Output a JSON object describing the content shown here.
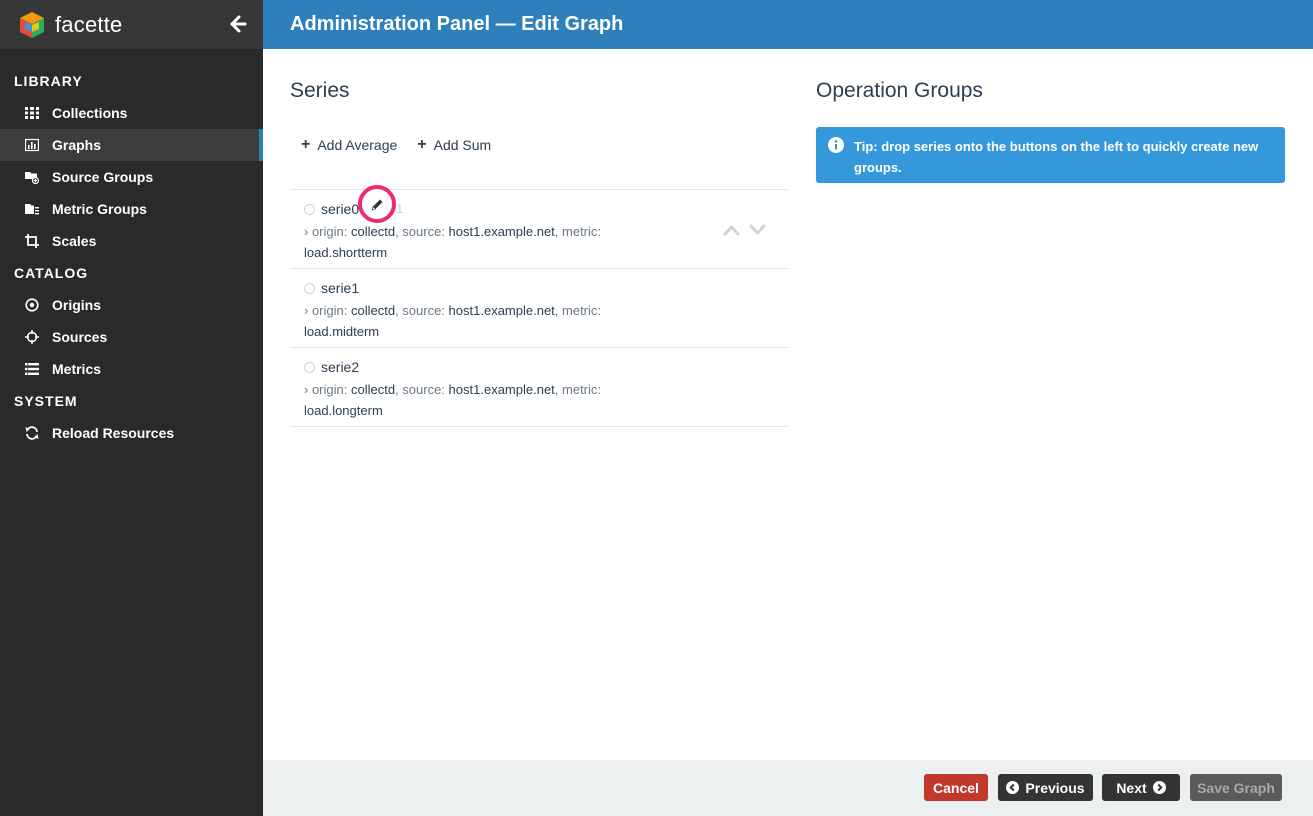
{
  "brand": {
    "name": "facette"
  },
  "sidebar": {
    "sections": [
      {
        "title": "LIBRARY",
        "items": [
          {
            "label": "Collections",
            "icon": "grid-icon"
          },
          {
            "label": "Graphs",
            "icon": "bar-chart-icon",
            "active": true
          },
          {
            "label": "Source Groups",
            "icon": "folder-plus-icon"
          },
          {
            "label": "Metric Groups",
            "icon": "folder-list-icon"
          },
          {
            "label": "Scales",
            "icon": "crop-icon"
          }
        ]
      },
      {
        "title": "CATALOG",
        "items": [
          {
            "label": "Origins",
            "icon": "dot-circle-icon"
          },
          {
            "label": "Sources",
            "icon": "crosshairs-icon"
          },
          {
            "label": "Metrics",
            "icon": "list-icon"
          }
        ]
      },
      {
        "title": "SYSTEM",
        "items": [
          {
            "label": "Reload Resources",
            "icon": "refresh-icon"
          }
        ]
      }
    ]
  },
  "header": {
    "title": "Administration Panel — Edit Graph"
  },
  "series_panel": {
    "title": "Series",
    "add_average": "Add Average",
    "add_sum": "Add Sum",
    "items": [
      {
        "name": "serie0",
        "ghost": "1",
        "origin_label": "› origin:",
        "origin": "collectd",
        "source_label": ", source:",
        "source": "host1.example.net",
        "metric_label": ", metric:",
        "metric": "load.shortterm"
      },
      {
        "name": "serie1",
        "origin_label": "› origin:",
        "origin": "collectd",
        "source_label": ", source:",
        "source": "host1.example.net",
        "metric_label": ", metric:",
        "metric": "load.midterm"
      },
      {
        "name": "serie2",
        "origin_label": "› origin:",
        "origin": "collectd",
        "source_label": ", source:",
        "source": "host1.example.net",
        "metric_label": ", metric:",
        "metric": "load.longterm"
      }
    ]
  },
  "operations_panel": {
    "title": "Operation Groups",
    "tip": "Tip: drop series onto the buttons on the left to quickly create new groups."
  },
  "footer": {
    "cancel": "Cancel",
    "previous": "Previous",
    "next": "Next",
    "save": "Save Graph"
  },
  "colors": {
    "accent": "#2e80bc",
    "highlight": "#ec2b72",
    "danger": "#c0392b",
    "tip": "#3498db"
  }
}
